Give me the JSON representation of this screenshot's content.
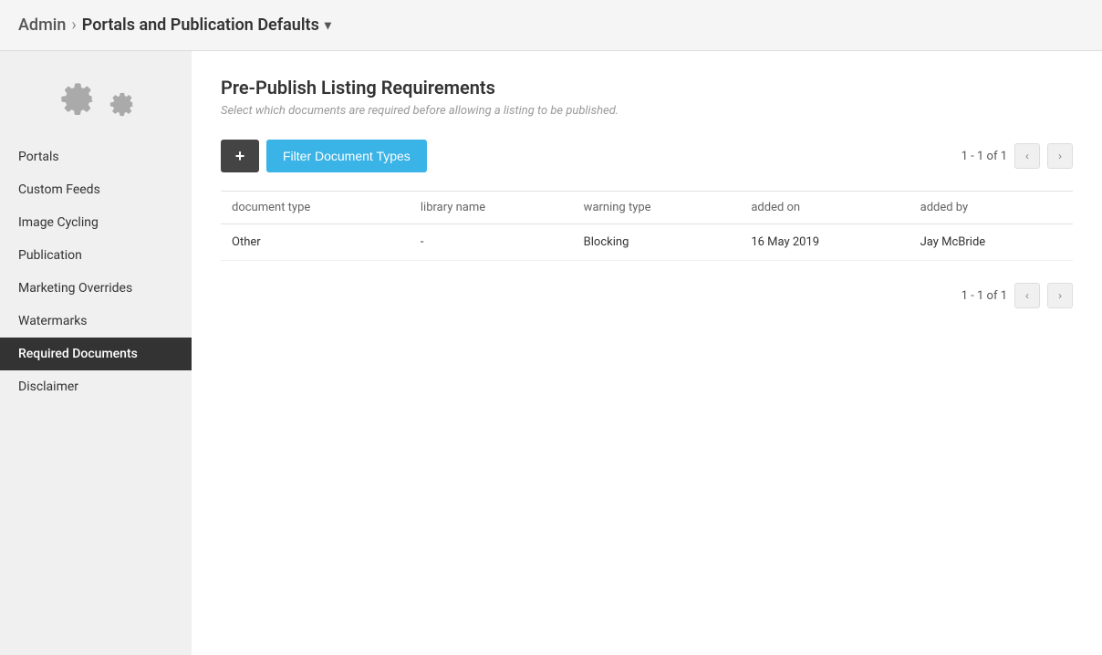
{
  "header": {
    "admin_label": "Admin",
    "separator": "›",
    "title": "Portals and Publication Defaults",
    "dropdown_arrow": "▾"
  },
  "sidebar": {
    "nav_items": [
      {
        "id": "portals",
        "label": "Portals",
        "active": false
      },
      {
        "id": "custom-feeds",
        "label": "Custom Feeds",
        "active": false
      },
      {
        "id": "image-cycling",
        "label": "Image Cycling",
        "active": false
      },
      {
        "id": "publication",
        "label": "Publication",
        "active": false
      },
      {
        "id": "marketing-overrides",
        "label": "Marketing Overrides",
        "active": false
      },
      {
        "id": "watermarks",
        "label": "Watermarks",
        "active": false
      },
      {
        "id": "required-documents",
        "label": "Required Documents",
        "active": true
      },
      {
        "id": "disclaimer",
        "label": "Disclaimer",
        "active": false
      }
    ]
  },
  "content": {
    "page_title": "Pre-Publish Listing Requirements",
    "page_subtitle": "Select which documents are required before allowing a listing to be published.",
    "toolbar": {
      "add_label": "+",
      "filter_label": "Filter Document Types",
      "pagination_text": "1 - 1 of 1"
    },
    "table": {
      "columns": [
        {
          "id": "document_type",
          "label": "document type"
        },
        {
          "id": "library_name",
          "label": "library name"
        },
        {
          "id": "warning_type",
          "label": "warning type"
        },
        {
          "id": "added_on",
          "label": "added on"
        },
        {
          "id": "added_by",
          "label": "added by"
        }
      ],
      "rows": [
        {
          "document_type": "Other",
          "library_name": "-",
          "warning_type": "Blocking",
          "added_on": "16 May 2019",
          "added_by": "Jay McBride"
        }
      ]
    },
    "bottom_pagination_text": "1 - 1 of 1"
  }
}
